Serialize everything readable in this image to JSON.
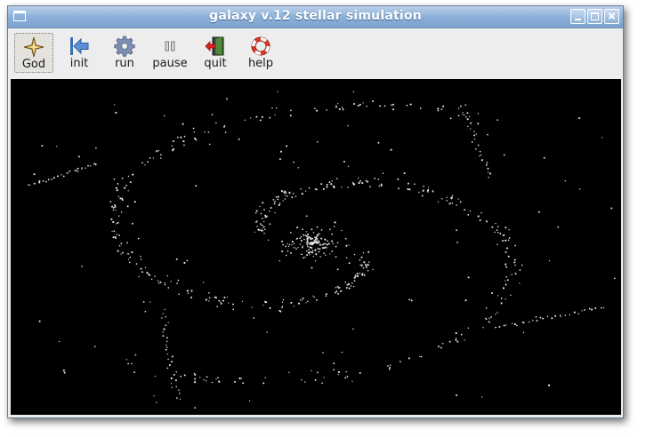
{
  "window": {
    "title": "galaxy v.12 stellar simulation"
  },
  "toolbar": {
    "buttons": [
      {
        "id": "god",
        "label": "God",
        "icon": "four-point-star-icon",
        "active": true
      },
      {
        "id": "init",
        "label": "init",
        "icon": "arrow-left-bar-icon",
        "active": false
      },
      {
        "id": "run",
        "label": "run",
        "icon": "gear-icon",
        "active": false
      },
      {
        "id": "pause",
        "label": "pause",
        "icon": "pause-icon",
        "active": false
      },
      {
        "id": "quit",
        "label": "quit",
        "icon": "exit-door-icon",
        "active": false
      },
      {
        "id": "help",
        "label": "help",
        "icon": "lifebuoy-icon",
        "active": false
      }
    ]
  },
  "colors": {
    "titlebar": "#8aaed6",
    "canvas_background": "#000000",
    "star": "#e8e8e8"
  }
}
